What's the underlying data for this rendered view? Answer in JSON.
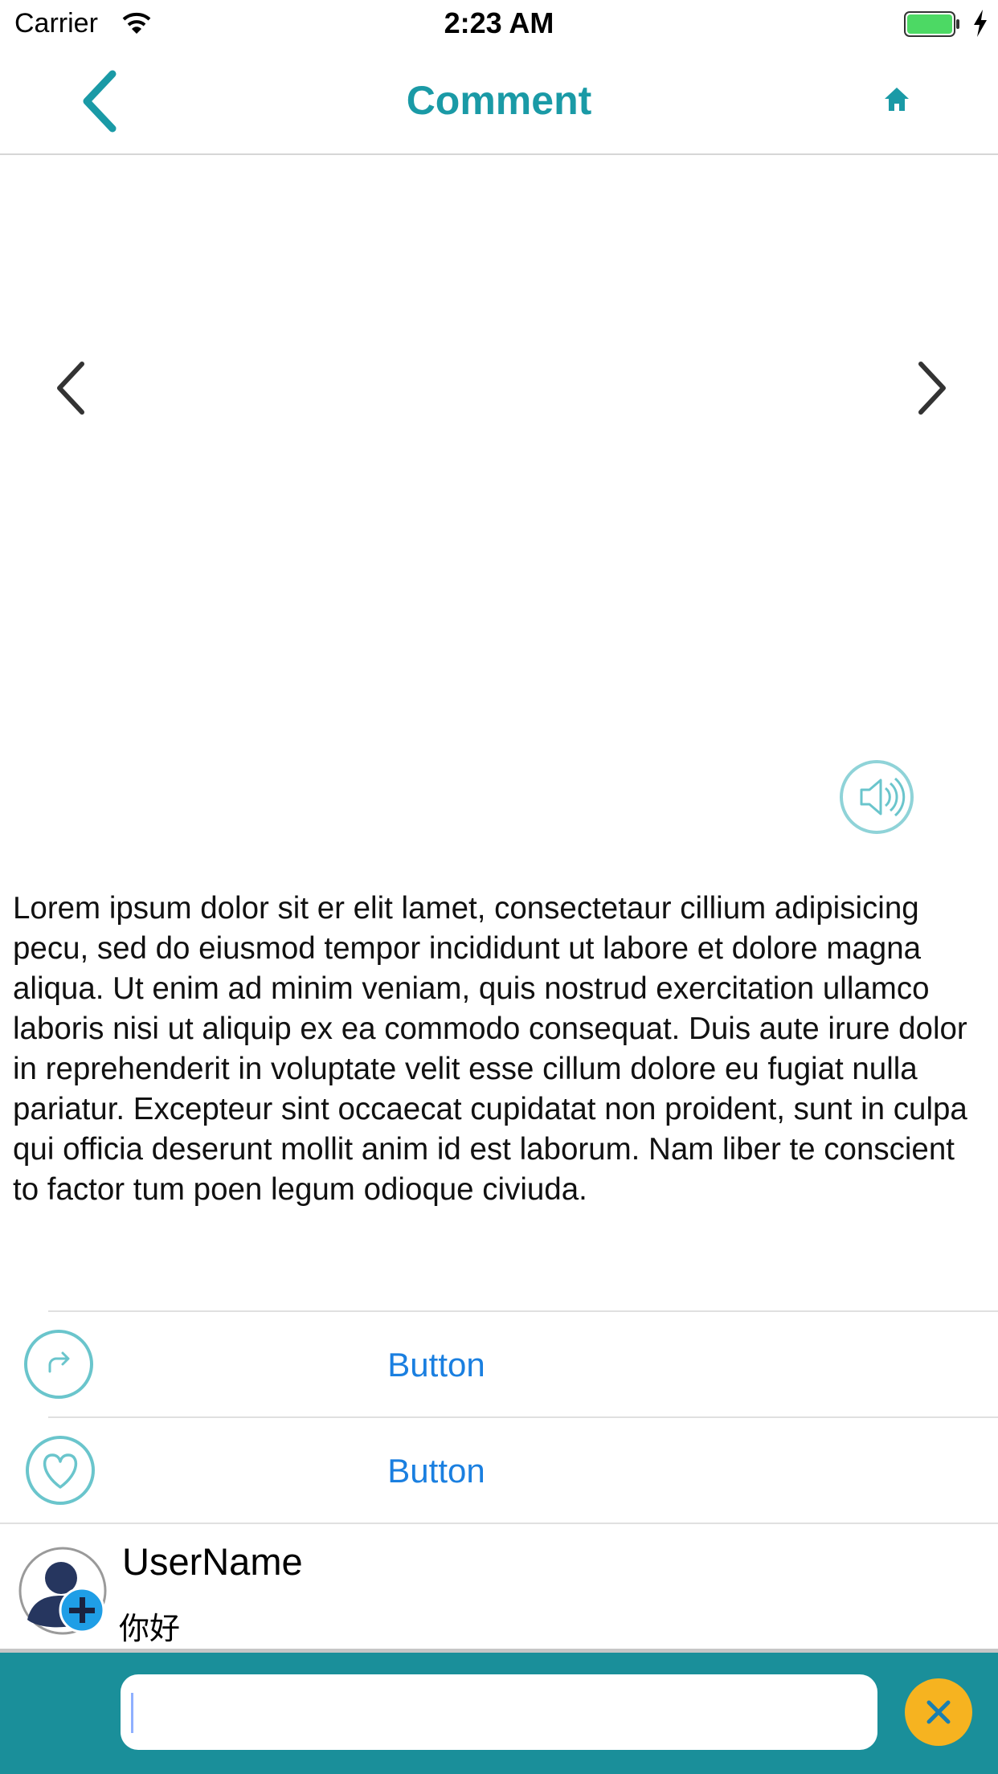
{
  "status_bar": {
    "carrier": "Carrier",
    "time": "2:23 AM"
  },
  "nav": {
    "title": "Comment",
    "back_icon": "chevron-left-icon",
    "home_icon": "home-icon"
  },
  "carousel": {
    "prev_icon": "chevron-left-icon",
    "next_icon": "chevron-right-icon",
    "sound_icon": "speaker-icon"
  },
  "article": {
    "text": "Lorem ipsum dolor sit er elit lamet, consectetaur cillium adipisicing pecu, sed do eiusmod tempor incididunt ut labore et dolore magna aliqua. Ut enim ad minim veniam, quis nostrud exercitation ullamco laboris nisi ut aliquip ex ea commodo consequat. Duis aute irure dolor in reprehenderit in voluptate velit esse cillum dolore eu fugiat nulla pariatur. Excepteur sint occaecat cupidatat non proident, sunt in culpa qui officia deserunt mollit anim id est laborum. Nam liber te conscient to factor tum poen legum odioque civiuda."
  },
  "actions": [
    {
      "icon": "share-icon",
      "label": "Button"
    },
    {
      "icon": "heart-icon",
      "label": "Button"
    }
  ],
  "comment": {
    "username": "UserName",
    "text": "你好"
  },
  "input_bar": {
    "placeholder": "",
    "close_icon": "close-icon"
  },
  "colors": {
    "accent": "#1a9aa6",
    "link": "#1a7fe0",
    "input_bar_bg": "#1a8f9a",
    "close_button": "#f6b320",
    "battery": "#4cd964"
  }
}
